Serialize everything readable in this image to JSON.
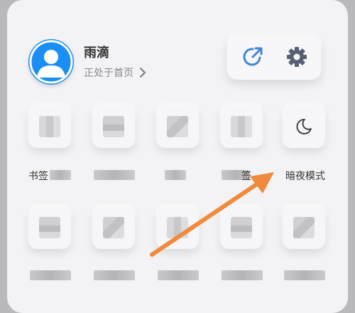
{
  "profile": {
    "name": "雨滴",
    "status": "正处于首页"
  },
  "actions": {
    "share_icon": "share-refresh-icon",
    "settings_icon": "gear-icon"
  },
  "grid": {
    "row1": [
      {
        "label": "书签",
        "icon": "pixelated-icon"
      },
      {
        "label": "",
        "icon": "pixelated-icon"
      },
      {
        "label": "",
        "icon": "pixelated-icon"
      },
      {
        "label": "签",
        "icon": "pixelated-icon"
      },
      {
        "label": "暗夜模式",
        "icon": "moon-icon"
      }
    ]
  },
  "colors": {
    "accent": "#1a8ef5",
    "arrow": "#f08a3c"
  }
}
